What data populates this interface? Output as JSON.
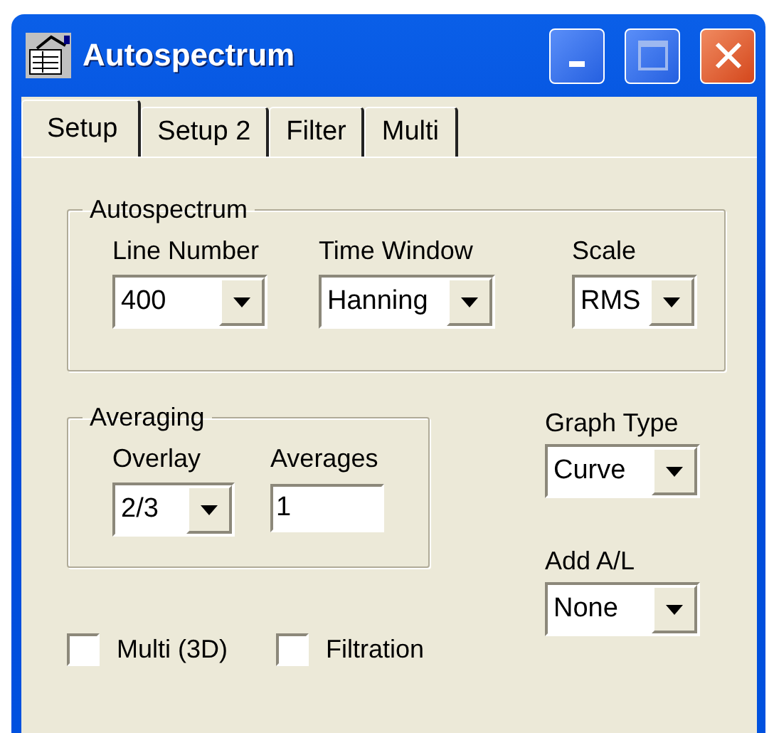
{
  "window": {
    "title": "Autospectrum"
  },
  "tabs": [
    {
      "label": "Setup",
      "selected": true
    },
    {
      "label": "Setup 2",
      "selected": false
    },
    {
      "label": "Filter",
      "selected": false
    },
    {
      "label": "Multi",
      "selected": false
    }
  ],
  "autospectrum_group": {
    "title": "Autospectrum",
    "fields": [
      {
        "label": "Line Number",
        "value": "400"
      },
      {
        "label": "Time Window",
        "value": "Hanning"
      },
      {
        "label": "Scale",
        "value": "RMS"
      }
    ]
  },
  "averaging_group": {
    "title": "Averaging",
    "overlay": {
      "label": "Overlay",
      "value": "2/3"
    },
    "averages": {
      "label": "Averages",
      "value": "1"
    }
  },
  "graph_type": {
    "label": "Graph Type",
    "value": "Curve"
  },
  "add_al": {
    "label": "Add A/L",
    "value": "None"
  },
  "checkboxes": [
    {
      "label": "Multi (3D)",
      "checked": false
    },
    {
      "label": "Filtration",
      "checked": false
    }
  ]
}
